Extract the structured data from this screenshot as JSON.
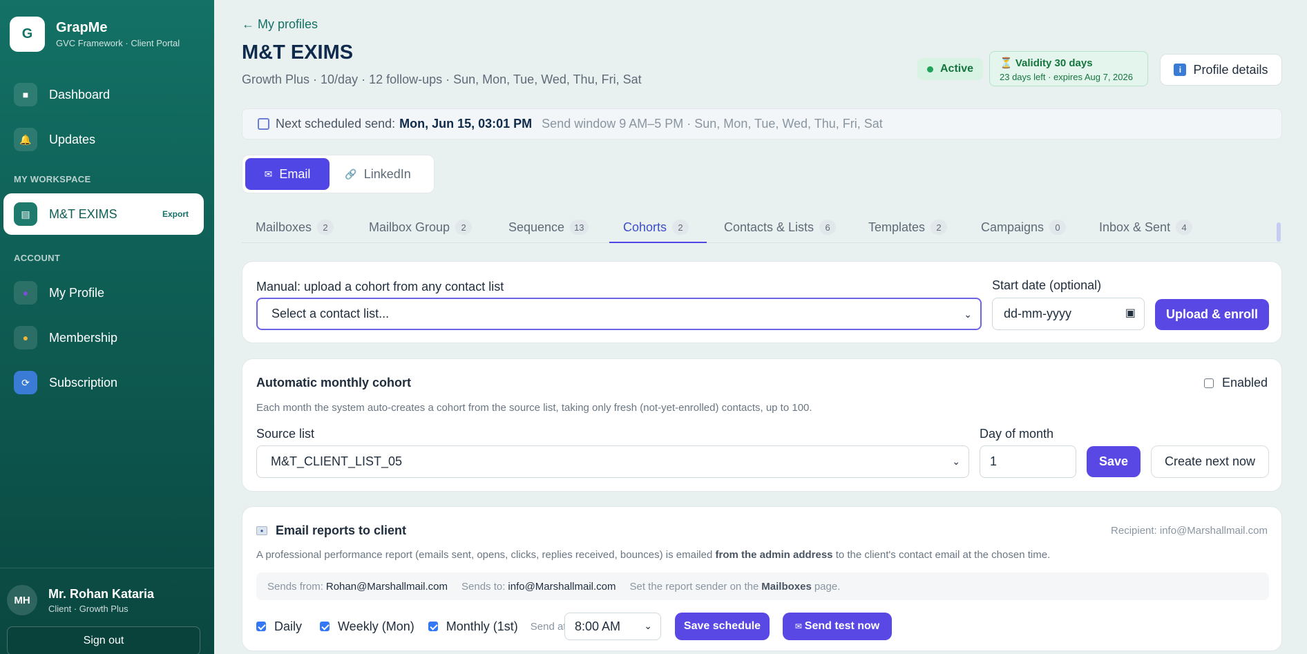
{
  "brand": {
    "logo_letter": "G",
    "name": "GrapMe",
    "subtitle": "GVC Framework · Client Portal"
  },
  "sidebar": {
    "items_top": [
      {
        "label": "Dashboard",
        "icon": "dashboard-icon"
      },
      {
        "label": "Updates",
        "icon": "bell-icon"
      }
    ],
    "workspace_label": "MY WORKSPACE",
    "workspace_item": {
      "label": "M&T EXIMS",
      "badge": "Export",
      "icon": "building-icon"
    },
    "account_label": "ACCOUNT",
    "account_items": [
      {
        "label": "My Profile",
        "icon": "user-icon"
      },
      {
        "label": "Membership",
        "icon": "coin-icon"
      },
      {
        "label": "Subscription",
        "icon": "refresh-icon"
      }
    ],
    "user": {
      "initials": "MH",
      "name": "Mr. Rohan Kataria",
      "plan": "Client · Growth Plus"
    },
    "signout": "Sign out"
  },
  "header": {
    "back": "← My profiles",
    "title": "M&T EXIMS",
    "subtitle": "Growth Plus · 10/day · 12 follow-ups · Sun, Mon, Tue, Wed, Thu, Fri, Sat",
    "status": "Active",
    "validity_title": "⏳ Validity 30 days",
    "validity_sub": "23 days left · expires Aug 7, 2026",
    "profile_btn": "Profile details"
  },
  "next_send": {
    "label": "Next scheduled send:",
    "value": "Mon, Jun 15, 03:01 PM",
    "window": "Send window 9 AM–5 PM · Sun, Mon, Tue, Wed, Thu, Fri, Sat"
  },
  "channels": {
    "email": "Email",
    "linkedin": "LinkedIn"
  },
  "tabs": [
    {
      "label": "Mailboxes",
      "count": "2"
    },
    {
      "label": "Mailbox Group",
      "count": "2"
    },
    {
      "label": "Sequence",
      "count": "13"
    },
    {
      "label": "Cohorts",
      "count": "2"
    },
    {
      "label": "Contacts & Lists",
      "count": "6"
    },
    {
      "label": "Templates",
      "count": "2"
    },
    {
      "label": "Campaigns",
      "count": "0"
    },
    {
      "label": "Inbox & Sent",
      "count": "4"
    }
  ],
  "manual": {
    "label": "Manual: upload a cohort from any contact list",
    "select_value": "Select a contact list...",
    "date_label": "Start date (optional)",
    "date_value": "dd-mm-yyyy",
    "button": "Upload & enroll"
  },
  "auto": {
    "title": "Automatic monthly cohort",
    "enabled_label": "Enabled",
    "desc": "Each month the system auto-creates a cohort from the source list, taking only fresh (not-yet-enrolled) contacts, up to 100.",
    "source_label": "Source list",
    "source_value": "M&T_CLIENT_LIST_05",
    "day_label": "Day of month",
    "day_value": "1",
    "save": "Save",
    "create_next": "Create next now"
  },
  "reports": {
    "title": "Email reports to client",
    "recipient": "Recipient: info@Marshallmail.com",
    "desc_pre": "A professional performance report (emails sent, opens, clicks, replies received, bounces) is emailed ",
    "desc_bold": "from the admin address",
    "desc_post": " to the client's contact email at the chosen time.",
    "sends_from_label": "Sends from:",
    "sends_from": "Rohan@Marshallmail.com",
    "sends_to_label": "Sends to:",
    "sends_to": "info@Marshallmail.com",
    "note_pre": "Set the report sender on the",
    "note_link": "Mailboxes",
    "note_post": "page.",
    "daily": "Daily",
    "weekly": "Weekly (Mon)",
    "monthly": "Monthly (1st)",
    "send_at": "Send at",
    "time": "8:00 AM",
    "save_schedule": "Save schedule",
    "send_test": "Send test now"
  }
}
